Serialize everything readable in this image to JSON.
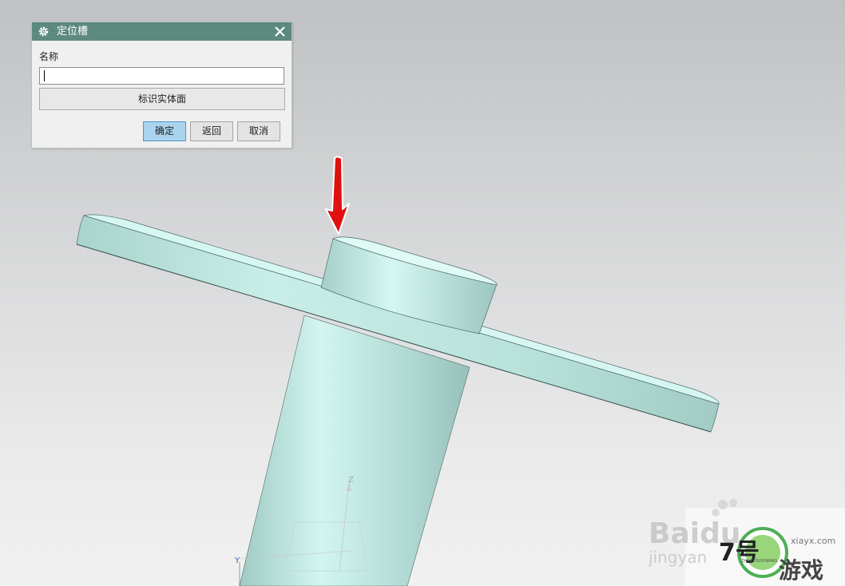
{
  "dialog": {
    "title": "定位槽",
    "name_label": "名称",
    "name_value": "",
    "identify_button": "标识实体面",
    "ok_button": "确定",
    "back_button": "返回",
    "cancel_button": "取消",
    "close_glyph": "✕",
    "titlebar_color": "#5d8a7f",
    "ok_color": "#a9d4ee"
  },
  "viewport": {
    "model_color": "#bfe9e3",
    "arrow_color": "#e01010",
    "axis_z_label": "Z",
    "axis_y_label": "Y"
  },
  "watermark": {
    "baidu_text": "Baidu",
    "jingyan_text": "jingyan",
    "brand_number": "7号",
    "brand_game": "游戏",
    "site_text": "xiayx.com",
    "pinyin_text": "ZHAOYOUXIWANG"
  },
  "icons": {
    "title_icon": "gear-icon",
    "close_icon": "close-icon",
    "arrow": "down-arrow-annotation",
    "triad": "wcs-axis-triad"
  }
}
